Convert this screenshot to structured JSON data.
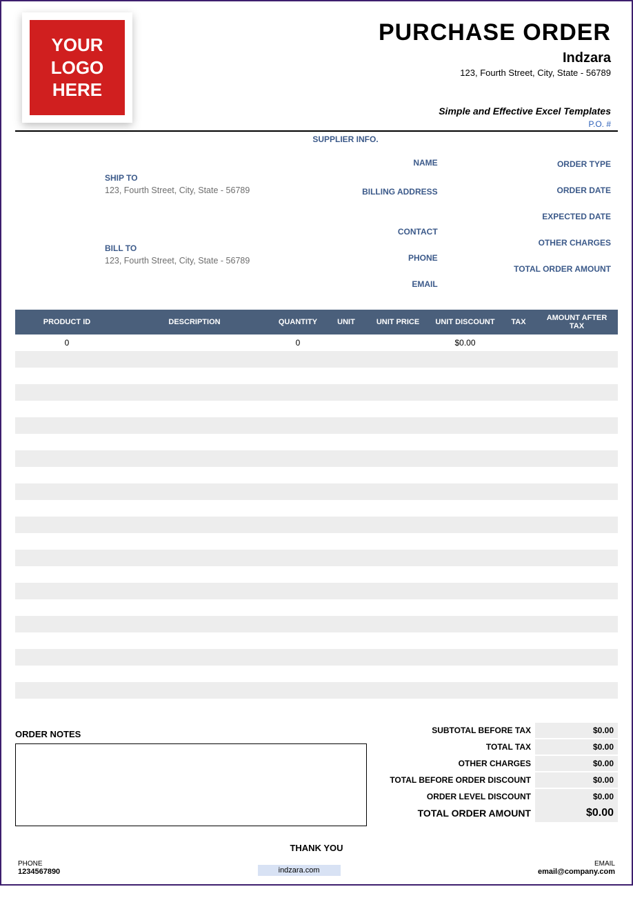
{
  "logo": {
    "line1": "YOUR",
    "line2": "LOGO",
    "line3": "HERE"
  },
  "header": {
    "doc_title": "PURCHASE ORDER",
    "company": "Indzara",
    "address": "123, Fourth Street, City, State - 56789",
    "tagline": "Simple and Effective Excel Templates",
    "po_label": "P.O. #"
  },
  "ship_to": {
    "label": "SHIP TO",
    "value": "123, Fourth Street, City, State - 56789"
  },
  "bill_to": {
    "label": "BILL TO",
    "value": "123, Fourth Street, City, State - 56789"
  },
  "supplier": {
    "title": "SUPPLIER INFO.",
    "name_lbl": "NAME",
    "billing_lbl": "BILLING ADDRESS",
    "contact_lbl": "CONTACT",
    "phone_lbl": "PHONE",
    "email_lbl": "EMAIL"
  },
  "meta": {
    "order_type_lbl": "ORDER TYPE",
    "order_date_lbl": "ORDER DATE",
    "expected_lbl": "EXPECTED DATE",
    "other_charges_lbl": "OTHER CHARGES",
    "total_amount_lbl": "TOTAL ORDER AMOUNT"
  },
  "columns": {
    "product_id": "PRODUCT ID",
    "description": "DESCRIPTION",
    "quantity": "QUANTITY",
    "unit": "UNIT",
    "unit_price": "UNIT PRICE",
    "unit_discount": "UNIT DISCOUNT",
    "tax": "TAX",
    "amount_after_tax": "AMOUNT AFTER TAX"
  },
  "rows": [
    {
      "product_id": "0",
      "description": "",
      "quantity": "0",
      "unit": "",
      "unit_price": "",
      "unit_discount": "$0.00",
      "tax": "",
      "amount": ""
    }
  ],
  "empty_rows": 22,
  "notes": {
    "title": "ORDER NOTES"
  },
  "totals": {
    "subtotal_lbl": "SUBTOTAL BEFORE TAX",
    "subtotal": "$0.00",
    "total_tax_lbl": "TOTAL TAX",
    "total_tax": "$0.00",
    "other_lbl": "OTHER CHARGES",
    "other": "$0.00",
    "before_disc_lbl": "TOTAL BEFORE ORDER DISCOUNT",
    "before_disc": "$0.00",
    "disc_lbl": "ORDER LEVEL DISCOUNT",
    "disc": "$0.00",
    "grand_lbl": "TOTAL ORDER AMOUNT",
    "grand": "$0.00"
  },
  "thanks": "THANK YOU",
  "footer": {
    "phone_lbl": "PHONE",
    "phone": "1234567890",
    "site": "indzara.com",
    "email_lbl": "EMAIL",
    "email": "email@company.com"
  }
}
